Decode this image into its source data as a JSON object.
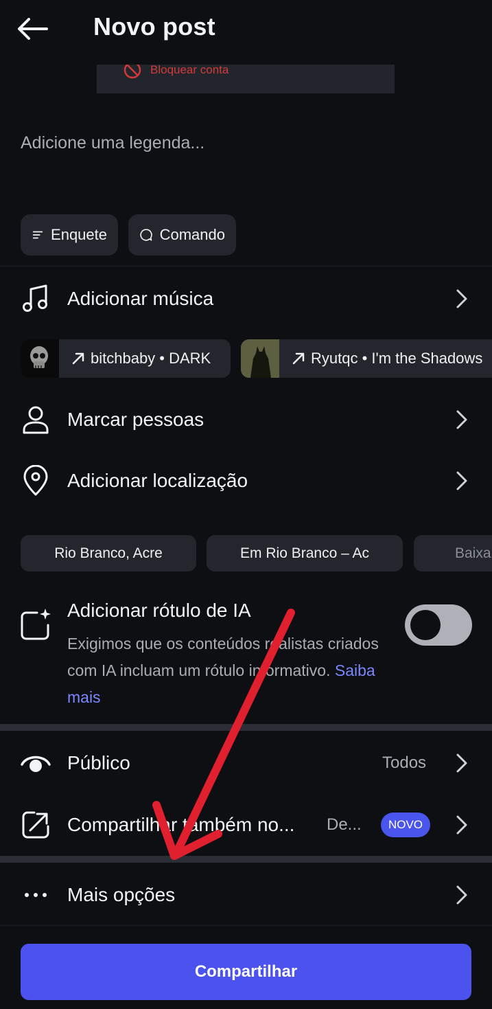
{
  "header": {
    "title": "Novo post"
  },
  "popup": {
    "block_label": "Bloquear conta"
  },
  "caption": {
    "placeholder": "Adicione uma legenda..."
  },
  "chips": {
    "poll_label": "Enquete",
    "prompt_label": "Comando"
  },
  "music": {
    "label": "Adicionar música",
    "suggestions": [
      {
        "text": "bitchbaby • DARK"
      },
      {
        "text": "Ryutqc • I'm the Shadows"
      }
    ]
  },
  "tag_people": {
    "label": "Marcar pessoas"
  },
  "location": {
    "label": "Adicionar localização",
    "suggestions": [
      "Rio Branco, Acre",
      "Em Rio Branco – Ac",
      "Baixa"
    ]
  },
  "ai_label": {
    "title": "Adicionar rótulo de IA",
    "description": "Exigimos que os conteúdos realistas criados com IA incluam um rótulo informativo.",
    "link": "Saiba mais",
    "enabled": false
  },
  "audience": {
    "label": "Público",
    "value": "Todos"
  },
  "share_also": {
    "label": "Compartilhar também no...",
    "value": "De...",
    "badge": "NOVO"
  },
  "more_options": {
    "label": "Mais opções"
  },
  "share_button": {
    "label": "Compartilhar"
  },
  "colors": {
    "background": "#0d0f12",
    "accent": "#4b52ee",
    "annotation_arrow": "#e0202e"
  }
}
